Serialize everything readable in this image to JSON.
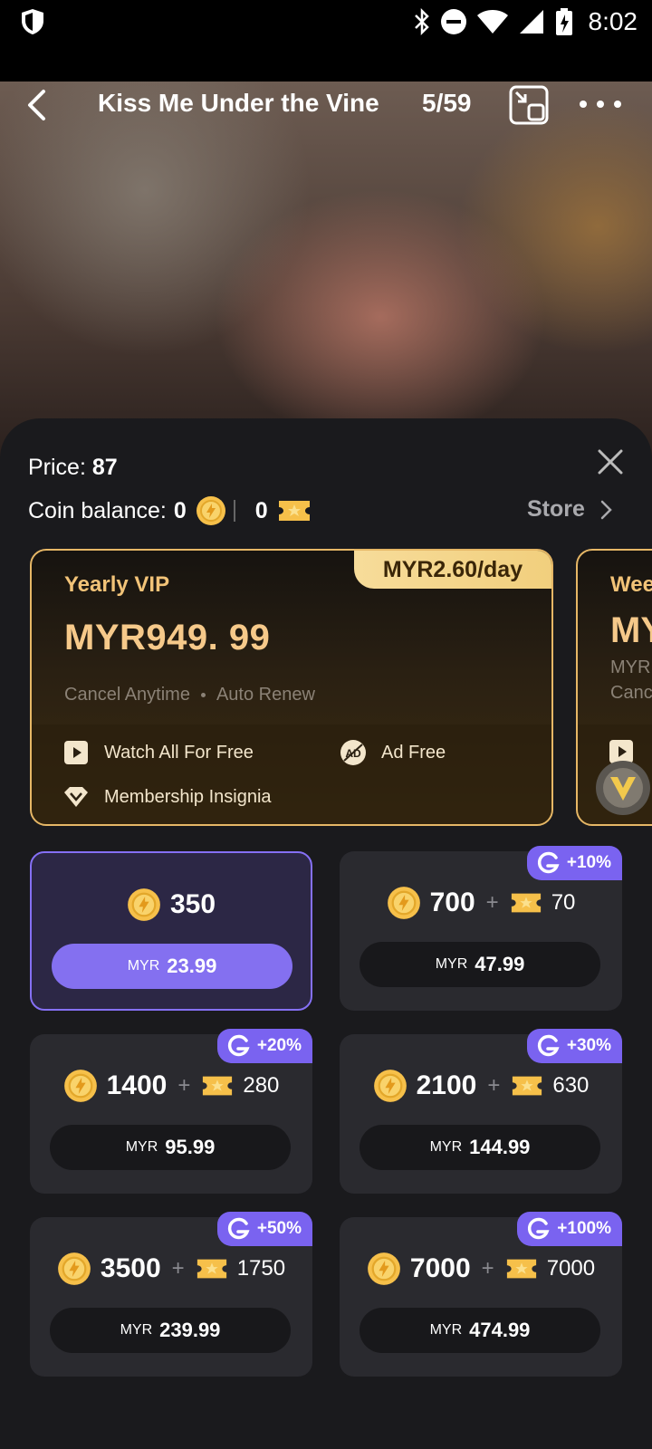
{
  "status_bar": {
    "time": "8:02"
  },
  "video": {
    "title": "Kiss Me Under the Vine",
    "episode": "5/59"
  },
  "sheet": {
    "price_label": "Price:",
    "price_value": "87",
    "balance_label": "Coin balance:",
    "coin_balance": "0",
    "ticket_balance": "0",
    "store_label": "Store"
  },
  "vip_plans": [
    {
      "name": "Yearly VIP",
      "price": "MYR949. 99",
      "per_day": "MYR2.60/day",
      "terms": [
        "Cancel Anytime",
        "Auto Renew"
      ],
      "perks": [
        "Watch All  For Free",
        "Ad Free",
        "Membership  Insignia"
      ]
    },
    {
      "name": "Wee",
      "price": "MY",
      "sub": "MYR",
      "cancel": "Canc"
    }
  ],
  "packs": [
    {
      "coins": "350",
      "bonus": "",
      "tag": "",
      "currency": "MYR",
      "price": "23.99",
      "selected": true
    },
    {
      "coins": "700",
      "bonus": "70",
      "tag": "+10%",
      "currency": "MYR",
      "price": "47.99"
    },
    {
      "coins": "1400",
      "bonus": "280",
      "tag": "+20%",
      "currency": "MYR",
      "price": "95.99"
    },
    {
      "coins": "2100",
      "bonus": "630",
      "tag": "+30%",
      "currency": "MYR",
      "price": "144.99"
    },
    {
      "coins": "3500",
      "bonus": "1750",
      "tag": "+50%",
      "currency": "MYR",
      "price": "239.99"
    },
    {
      "coins": "7000",
      "bonus": "7000",
      "tag": "+100%",
      "currency": "MYR",
      "price": "474.99"
    }
  ],
  "icons": {
    "coin": "coin-icon",
    "ticket": "ticket-icon",
    "tag": "g-icon"
  },
  "colors": {
    "accent": "#8470f0",
    "gold": "#f6c98a",
    "sheet_bg": "#1a1a1d"
  }
}
